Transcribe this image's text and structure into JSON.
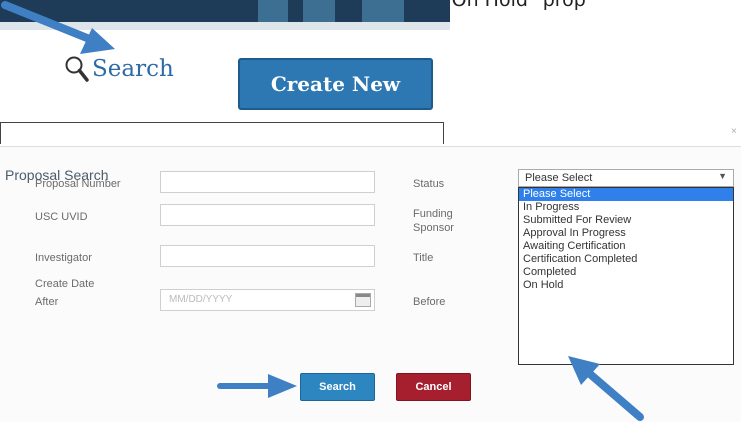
{
  "intro_text": "see the search function, and search for status \"On Hold\" prop",
  "header": {
    "search_label": "Search",
    "create_label": "Create New"
  },
  "modal": {
    "title": "Proposal Search",
    "close_glyph": "×",
    "fields": {
      "proposal_number": "Proposal Number",
      "usc_uvid": "USC UVID",
      "investigator": "Investigator",
      "create_date": "Create Date",
      "after": "After",
      "after_placeholder": "MM/DD/YYYY",
      "status": "Status",
      "funding_sponsor": "Funding Sponsor",
      "title": "Title",
      "before": "Before"
    },
    "status_select": {
      "selected": "Please Select",
      "options": [
        "Please Select",
        "In Progress",
        "Submitted For Review",
        "Approval In Progress",
        "Awaiting Certification",
        "Certification Completed",
        "Completed",
        "On Hold"
      ],
      "highlight_color": "#2f80ea"
    },
    "search_button": "Search",
    "cancel_button": "Cancel"
  },
  "colors": {
    "accent": "#2d78b2",
    "cancel": "#a51f2e",
    "arrow": "#3f7fc4"
  },
  "icons": {
    "search": "magnifier-icon",
    "calendar": "calendar-icon",
    "dropdown": "chevron-down-icon",
    "pointer": "arrow-icon"
  }
}
